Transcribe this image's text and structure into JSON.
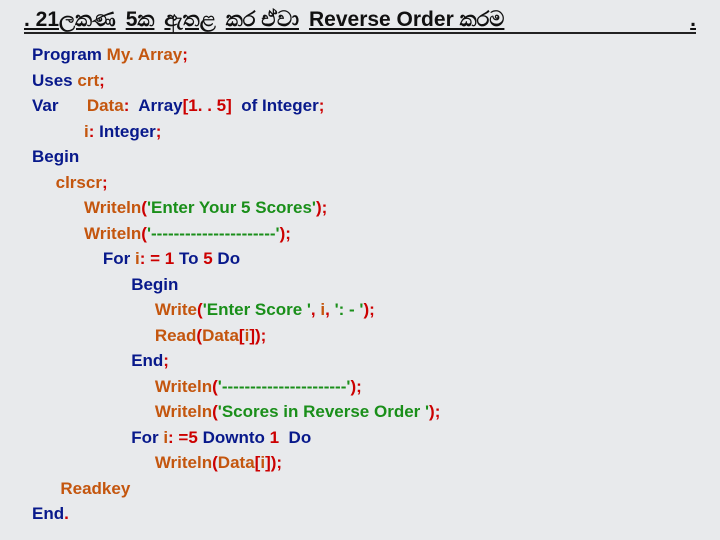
{
  "title": {
    "p1": ". 21ලකණ",
    "p2": "5ක",
    "p3": "ඇතළ",
    "p4": "කර ඒවා",
    "p5": "Reverse Order කරම",
    "p6": "."
  },
  "code": {
    "kw_program": "Program",
    "id_myarray": "My. Array",
    "sc": ";",
    "kw_uses": "Uses",
    "id_crt": "crt",
    "kw_var": "Var",
    "id_data": "Data",
    "colon": ":",
    "kw_array": "Array",
    "lb": "[",
    "n1": "1",
    "dots": ". .",
    "n5": "5",
    "rb": "]",
    "kw_of": "of",
    "kw_integer": "Integer",
    "id_i": "i",
    "kw_begin": "Begin",
    "id_clrscr": "clrscr",
    "id_writeln": "Writeln",
    "lp": "(",
    "rp": ")",
    "str_scores": "'Enter Your 5 Scores'",
    "str_dashes": "'----------------------'",
    "kw_for": "For",
    "id_i2": "i",
    "assign": ": =",
    "n1b": "1",
    "kw_to": "To",
    "n5b": "5",
    "kw_do": "Do",
    "kw_begin2": "Begin",
    "id_write": "Write",
    "str_enter": "'Enter Score '",
    "comma": ",",
    "str_colondash": "': - '",
    "id_read": "Read",
    "kw_end": "End",
    "str_dashes2": "'----------------------'",
    "str_rev": "'Scores in Reverse Order '",
    "kw_for2": "For",
    "assign2": ": =",
    "n5c": "5",
    "kw_downto": "Downto",
    "n1c": "1",
    "kw_do2": "Do",
    "id_readkey": "Readkey",
    "kw_end2": "End",
    "period": "."
  }
}
